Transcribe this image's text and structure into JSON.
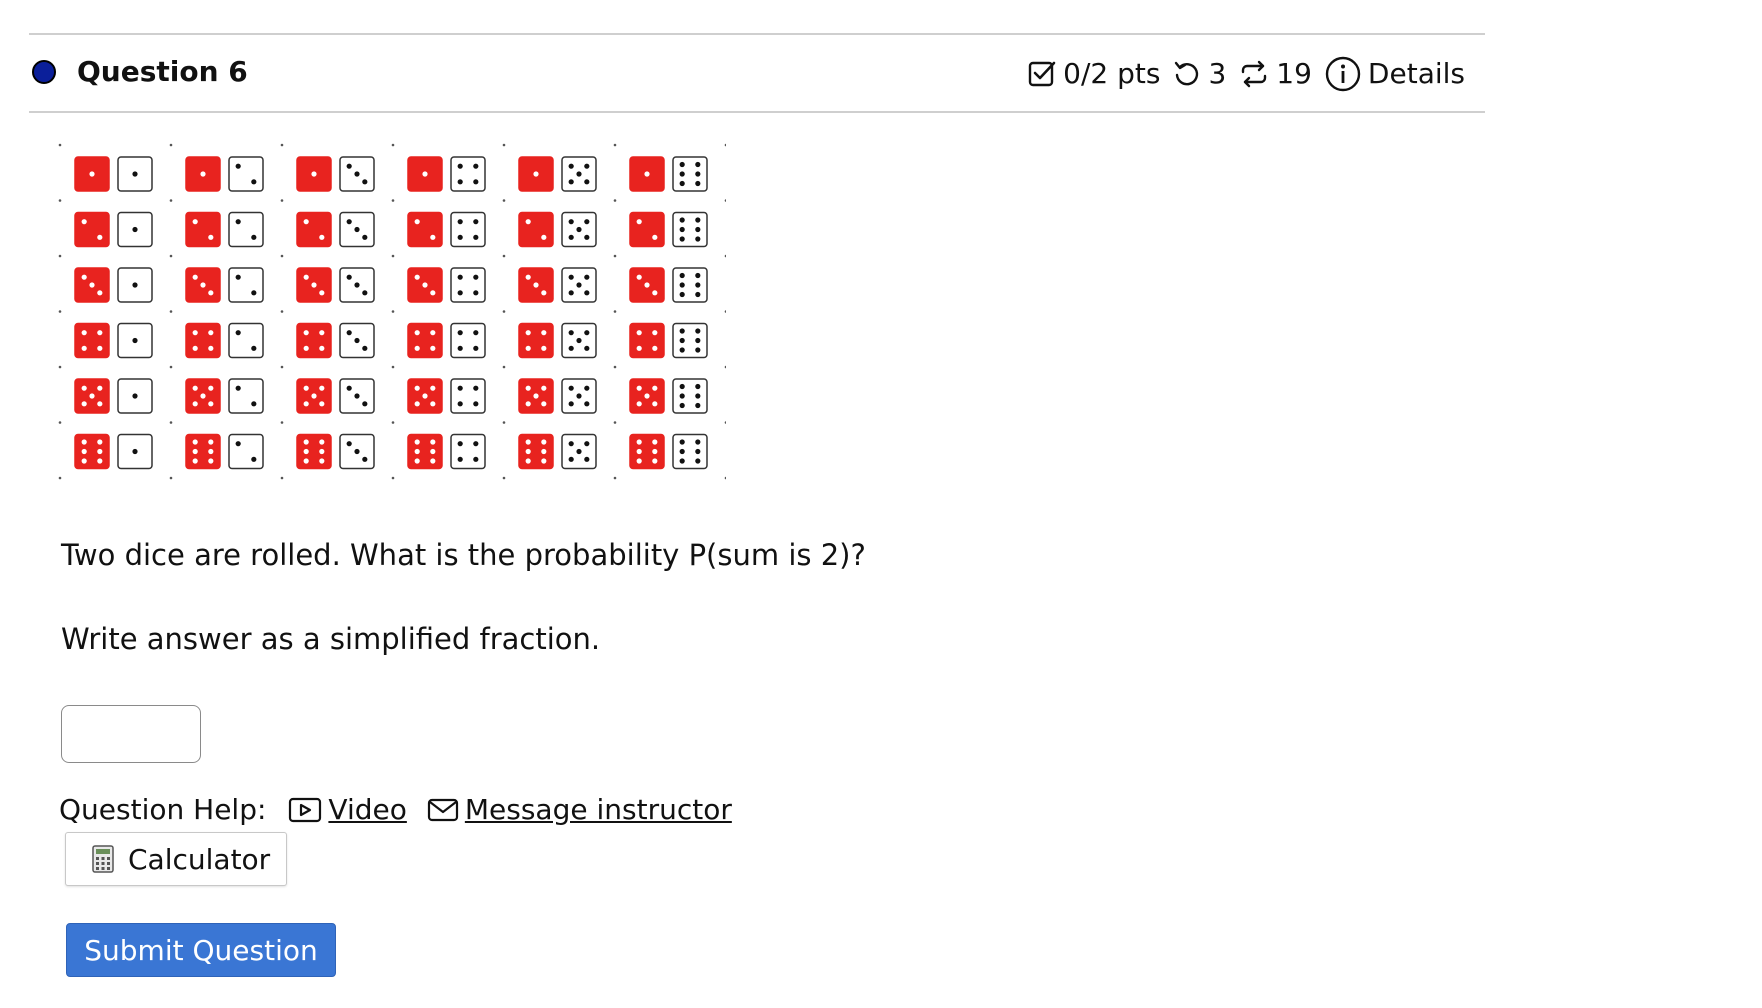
{
  "question": {
    "title": "Question 6",
    "status_color": "#0b1f9a",
    "points": "0/2 pts",
    "attempts": "3",
    "versions": "19",
    "details_label": "Details"
  },
  "figure": {
    "description_icon": "dice-grid",
    "rows": 6,
    "cols": 6,
    "red_die_color": "#e8231f"
  },
  "prompt": {
    "line1": "Two dice are rolled. What is the probability P(sum is 2)?",
    "line2": "Write answer as a simplified fraction."
  },
  "answer": {
    "value": "",
    "placeholder": ""
  },
  "help": {
    "label": "Question Help:",
    "video": "Video",
    "message": "Message instructor"
  },
  "buttons": {
    "calculator": "Calculator",
    "submit": "Submit Question",
    "submit_color": "#3a76d4"
  }
}
